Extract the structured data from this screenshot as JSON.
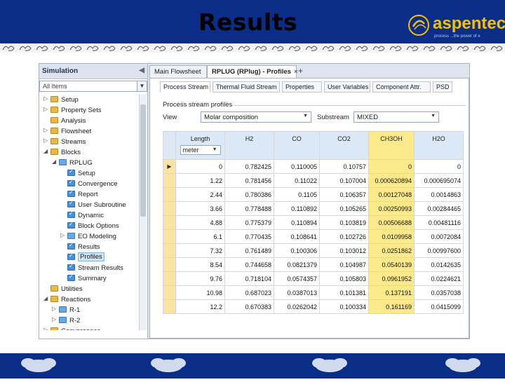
{
  "slide": {
    "title": "Results",
    "logo_text": "aspentech",
    "logo_tagline": "process ...the power of e"
  },
  "nav": {
    "header": "Simulation",
    "collapse_icon": "chevron-left-icon",
    "filter_value": "All Items",
    "tree": [
      {
        "label": "Setup",
        "indent": 1,
        "arrow": "▷",
        "icon": "folder"
      },
      {
        "label": "Property Sets",
        "indent": 1,
        "arrow": "▷",
        "icon": "folder"
      },
      {
        "label": "Analysis",
        "indent": 1,
        "arrow": "",
        "icon": "folder"
      },
      {
        "label": "Flowsheet",
        "indent": 1,
        "arrow": "▷",
        "icon": "folder"
      },
      {
        "label": "Streams",
        "indent": 1,
        "arrow": "▷",
        "icon": "folder"
      },
      {
        "label": "Blocks",
        "indent": 1,
        "arrow": "◢",
        "icon": "folder"
      },
      {
        "label": "RPLUG",
        "indent": 2,
        "arrow": "◢",
        "icon": "blue"
      },
      {
        "label": "Setup",
        "indent": 3,
        "arrow": "",
        "icon": "ok"
      },
      {
        "label": "Convergence",
        "indent": 3,
        "arrow": "",
        "icon": "ok"
      },
      {
        "label": "Report",
        "indent": 3,
        "arrow": "",
        "icon": "ok"
      },
      {
        "label": "User Subroutine",
        "indent": 3,
        "arrow": "",
        "icon": "ok"
      },
      {
        "label": "Dynamic",
        "indent": 3,
        "arrow": "",
        "icon": "ok"
      },
      {
        "label": "Block Options",
        "indent": 3,
        "arrow": "",
        "icon": "ok"
      },
      {
        "label": "EO Modeling",
        "indent": 3,
        "arrow": "▷",
        "icon": "blue"
      },
      {
        "label": "Results",
        "indent": 3,
        "arrow": "",
        "icon": "ok"
      },
      {
        "label": "Profiles",
        "indent": 3,
        "arrow": "",
        "icon": "ok"
      },
      {
        "label": "Stream Results",
        "indent": 3,
        "arrow": "",
        "icon": "ok"
      },
      {
        "label": "Summary",
        "indent": 3,
        "arrow": "",
        "icon": "ok"
      },
      {
        "label": "Utilities",
        "indent": 1,
        "arrow": "",
        "icon": "folder"
      },
      {
        "label": "Reactions",
        "indent": 1,
        "arrow": "◢",
        "icon": "folder"
      },
      {
        "label": "R-1",
        "indent": 2,
        "arrow": "▷",
        "icon": "blue"
      },
      {
        "label": "R-2",
        "indent": 2,
        "arrow": "▷",
        "icon": "blue"
      },
      {
        "label": "Convergence",
        "indent": 1,
        "arrow": "▷",
        "icon": "folder"
      }
    ]
  },
  "doc_tabs": [
    {
      "label": "Main Flowsheet",
      "active": false
    },
    {
      "label": "RPLUG (RPlug) - Profiles",
      "active": true
    }
  ],
  "sub_tabs": [
    "Process Stream",
    "Thermal Fluid Stream",
    "Properties",
    "User Variables",
    "Component Attr.",
    "PSD"
  ],
  "profiles": {
    "group_label": "Process stream profiles",
    "view_label": "View",
    "view_value": "Molar composition",
    "substream_label": "Substream",
    "substream_value": "MIXED"
  },
  "table": {
    "length_header": "Length",
    "length_unit": "meter",
    "columns": [
      "H2",
      "CO",
      "CO2",
      "CH3OH",
      "H2O"
    ],
    "highlight_column": "CH3OH",
    "rows": [
      [
        "0",
        "0.782425",
        "0.110005",
        "0.10757",
        "0",
        "0"
      ],
      [
        "1.22",
        "0.781456",
        "0.11022",
        "0.107004",
        "0.000620894",
        "0.000695074"
      ],
      [
        "2.44",
        "0.780386",
        "0.1105",
        "0.106357",
        "0.00127048",
        "0.0014863"
      ],
      [
        "3.66",
        "0.778488",
        "0.110892",
        "0.105265",
        "0.00250993",
        "0.00284465"
      ],
      [
        "4.88",
        "0.775379",
        "0.110894",
        "0.103819",
        "0.00506688",
        "0.00481116"
      ],
      [
        "6.1",
        "0.770435",
        "0.108641",
        "0.102726",
        "0.0109958",
        "0.0072084"
      ],
      [
        "7.32",
        "0.761489",
        "0.100306",
        "0.103012",
        "0.0251862",
        "0.00997600"
      ],
      [
        "8.54",
        "0.744658",
        "0.0821379",
        "0.104987",
        "0.0540139",
        "0.0142635"
      ],
      [
        "9.76",
        "0.718104",
        "0.0574357",
        "0.105803",
        "0.0961952",
        "0.0224621"
      ],
      [
        "10.98",
        "0.687023",
        "0.0387013",
        "0.101381",
        "0.137191",
        "0.0357038"
      ],
      [
        "12.2",
        "0.670383",
        "0.0262042",
        "0.100334",
        "0.161169",
        "0.0415099"
      ]
    ]
  }
}
